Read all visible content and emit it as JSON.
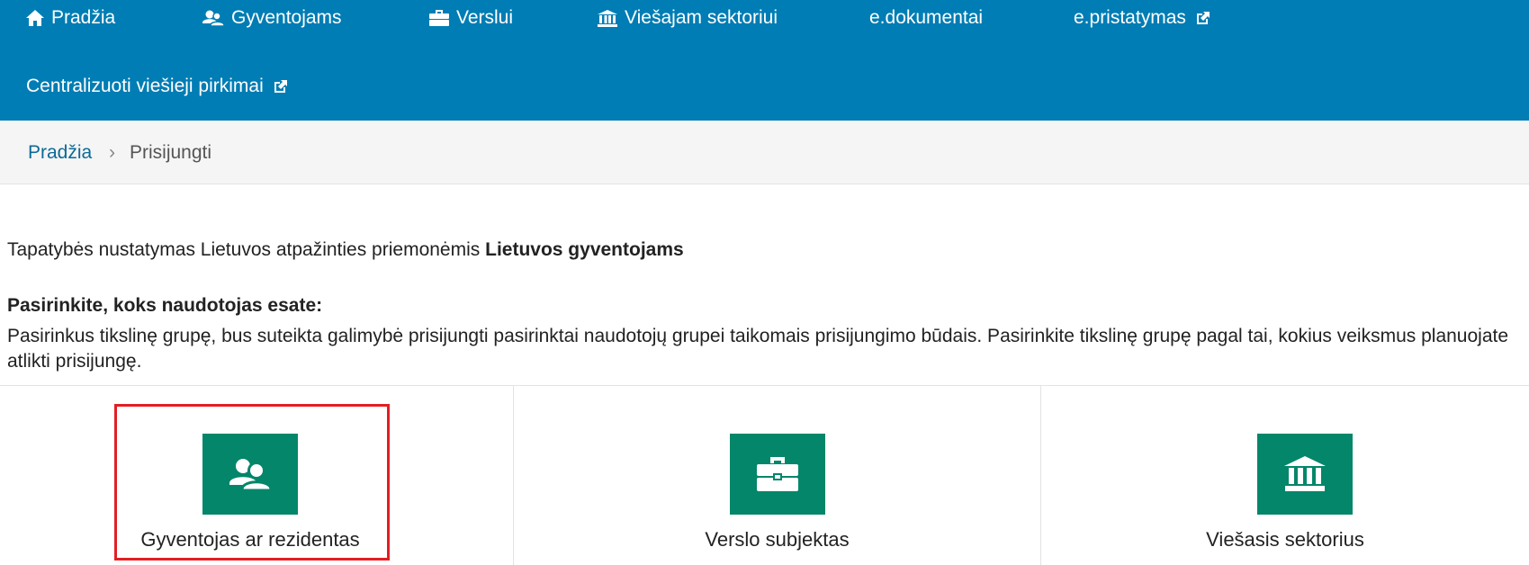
{
  "nav": {
    "items": [
      {
        "label": "Pradžia",
        "icon": "home-icon"
      },
      {
        "label": "Gyventojams",
        "icon": "users-icon"
      },
      {
        "label": "Verslui",
        "icon": "briefcase-icon"
      },
      {
        "label": "Viešajam sektoriui",
        "icon": "bank-icon"
      },
      {
        "label": "e.dokumentai"
      },
      {
        "label": "e.pristatymas",
        "icon": "external-link-icon"
      },
      {
        "label": "Centralizuoti viešieji pirkimai",
        "icon": "external-link-icon"
      }
    ],
    "colors": {
      "background": "#007db4",
      "text": "#ffffff"
    }
  },
  "breadcrumb": {
    "home": "Pradžia",
    "separator": "›",
    "current": "Prisijungti"
  },
  "intro": {
    "text": "Tapatybės nustatymas Lietuvos atpažinties priemonėmis",
    "bold": "Lietuvos gyventojams"
  },
  "choose": {
    "title": "Pasirinkite, koks naudotojas esate:",
    "description": "Pasirinkus tikslinę grupę, bus suteikta galimybė prisijungti pasirinktai naudotojų grupei taikomais prisijungimo būdais. Pasirinkite tikslinę grupę pagal tai, kokius veiksmus planuojate atlikti prisijungę."
  },
  "cards": [
    {
      "label": "Gyventojas ar rezidentas",
      "icon": "users-icon",
      "highlighted": true
    },
    {
      "label": "Verslo subjektas",
      "icon": "briefcase-icon"
    },
    {
      "label": "Viešasis sektorius",
      "icon": "bank-icon"
    }
  ],
  "colors": {
    "accent": "#03866a",
    "highlight": "#e31e24",
    "link": "#0c6a96"
  }
}
